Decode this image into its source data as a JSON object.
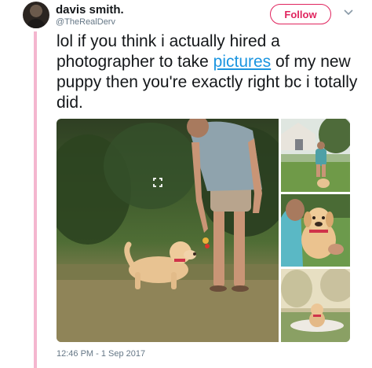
{
  "author": {
    "display_name": "davis smith.",
    "handle": "@TheRealDerv",
    "avatar_icon": "avatar-photo"
  },
  "actions": {
    "follow_label": "Follow",
    "more_icon": "chevron-down-icon"
  },
  "tweet": {
    "text_before": "lol if you think i actually hired a photographer to take ",
    "link_text": "pictures",
    "text_after": " of my new puppy then you're exactly right bc i totally did.",
    "timestamp": "12:46 PM - 1 Sep 2017"
  },
  "media": {
    "photos": [
      "man-with-puppy-photo",
      "yard-photo",
      "puppy-held-photo",
      "puppy-blanket-photo"
    ],
    "expand_icon": "expand-icon"
  },
  "colors": {
    "accent": "#e0245e",
    "link": "#1b95e0",
    "thread_line": "#f4b6cf",
    "muted_text": "#657786"
  }
}
